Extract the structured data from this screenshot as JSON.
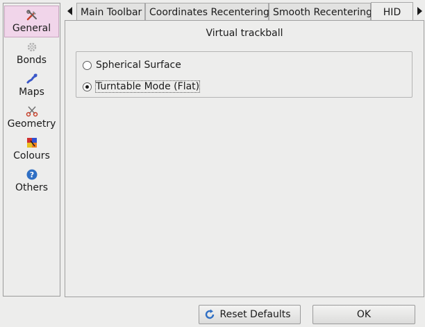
{
  "sidebar": {
    "items": [
      {
        "label": "General",
        "icon": "tools-icon",
        "active": true
      },
      {
        "label": "Bonds",
        "icon": "gear-icon",
        "active": false
      },
      {
        "label": "Maps",
        "icon": "map-icon",
        "active": false
      },
      {
        "label": "Geometry",
        "icon": "scissors-icon",
        "active": false
      },
      {
        "label": "Colours",
        "icon": "palette-icon",
        "active": false
      },
      {
        "label": "Others",
        "icon": "help-icon",
        "active": false
      }
    ]
  },
  "tabs": [
    {
      "label": "Main Toolbar",
      "active": false
    },
    {
      "label": "Coordinates Recentering",
      "active": false
    },
    {
      "label": "Smooth Recentering",
      "active": false
    },
    {
      "label": "HID",
      "active": true
    }
  ],
  "panel": {
    "title": "Virtual trackball",
    "options": [
      {
        "label": "Spherical Surface",
        "checked": false
      },
      {
        "label": "Turntable Mode (Flat)",
        "checked": true
      }
    ]
  },
  "buttons": {
    "reset": "Reset Defaults",
    "ok": "OK"
  },
  "colors": {
    "active_sidebar": "#f1d5ea",
    "background": "#ededec"
  }
}
